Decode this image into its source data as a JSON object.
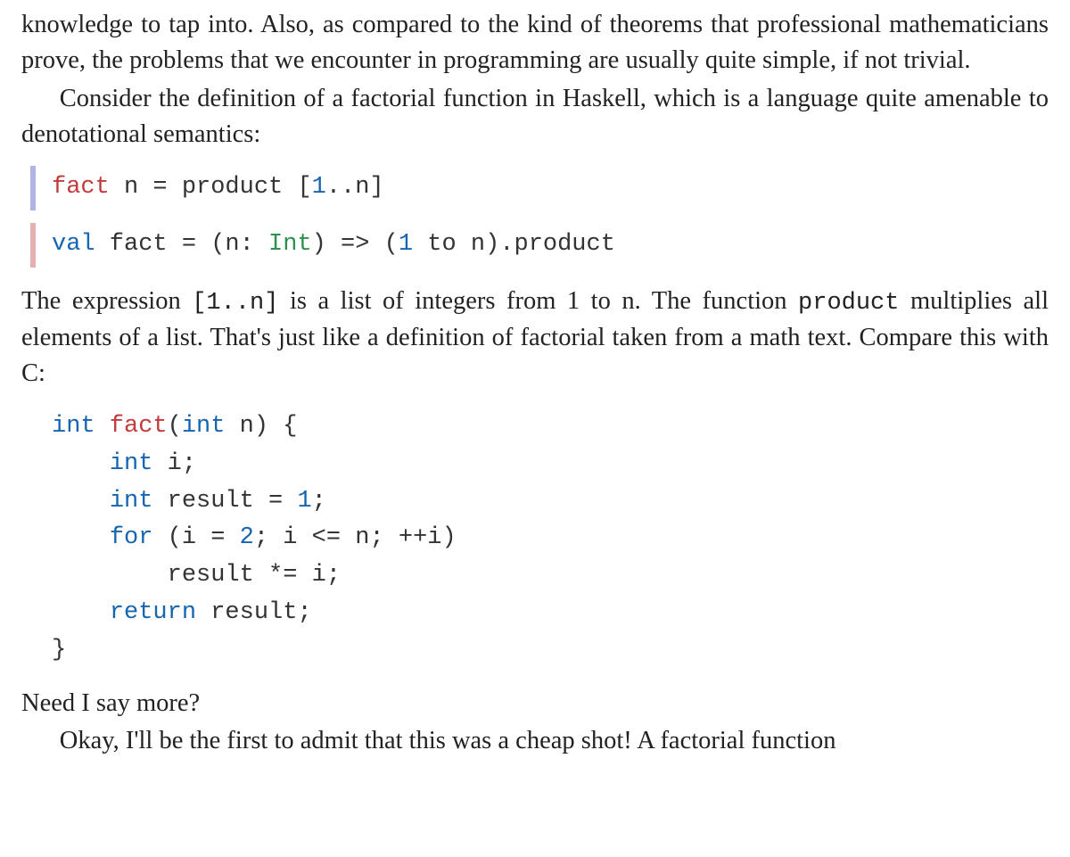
{
  "para1": {
    "line1": "knowledge to tap into. Also, as compared to the kind of theorems that professional mathematicians prove, the problems that we encounter in programming are usually quite simple, if not trivial."
  },
  "para2": {
    "line1": "Consider the definition of a factorial function in Haskell, which is a language quite amenable to denotational semantics:"
  },
  "code_haskell": {
    "fact": "fact",
    "n_eq_product": " n = product [",
    "one": "1",
    "dotdotn": "..n]"
  },
  "code_scala": {
    "val": "val",
    "fact_eq": " fact = (n: ",
    "Int": "Int",
    "rest_a": ") => (",
    "one": "1",
    "rest_b": " to n).product"
  },
  "para3": {
    "t1": "The expression ",
    "expr": "[1..n]",
    "t2": " is a list of integers from 1 to n. The function ",
    "prod": "product",
    "t3": " multiplies all elements of a list. That's just like a definition of factorial taken from a math text. Compare this with C:"
  },
  "code_c": {
    "int1": "int",
    "fact": " fact",
    "sig_a": "(",
    "int2": "int",
    "sig_b": " n) {",
    "indent1": "    ",
    "int3": "int",
    "i_decl": " i;",
    "int4": "int",
    "res_eq": " result = ",
    "one": "1",
    "semi": ";",
    "for": "for",
    "for_a": " (i = ",
    "two": "2",
    "for_b": "; i <= n; ++i)",
    "indent2": "        ",
    "body": "result *= i;",
    "return": "return",
    "ret_rest": " result;",
    "brace": "}"
  },
  "para4": "Need I say more?",
  "para5": "Okay, I'll be the first to admit that this was a cheap shot! A factorial function"
}
